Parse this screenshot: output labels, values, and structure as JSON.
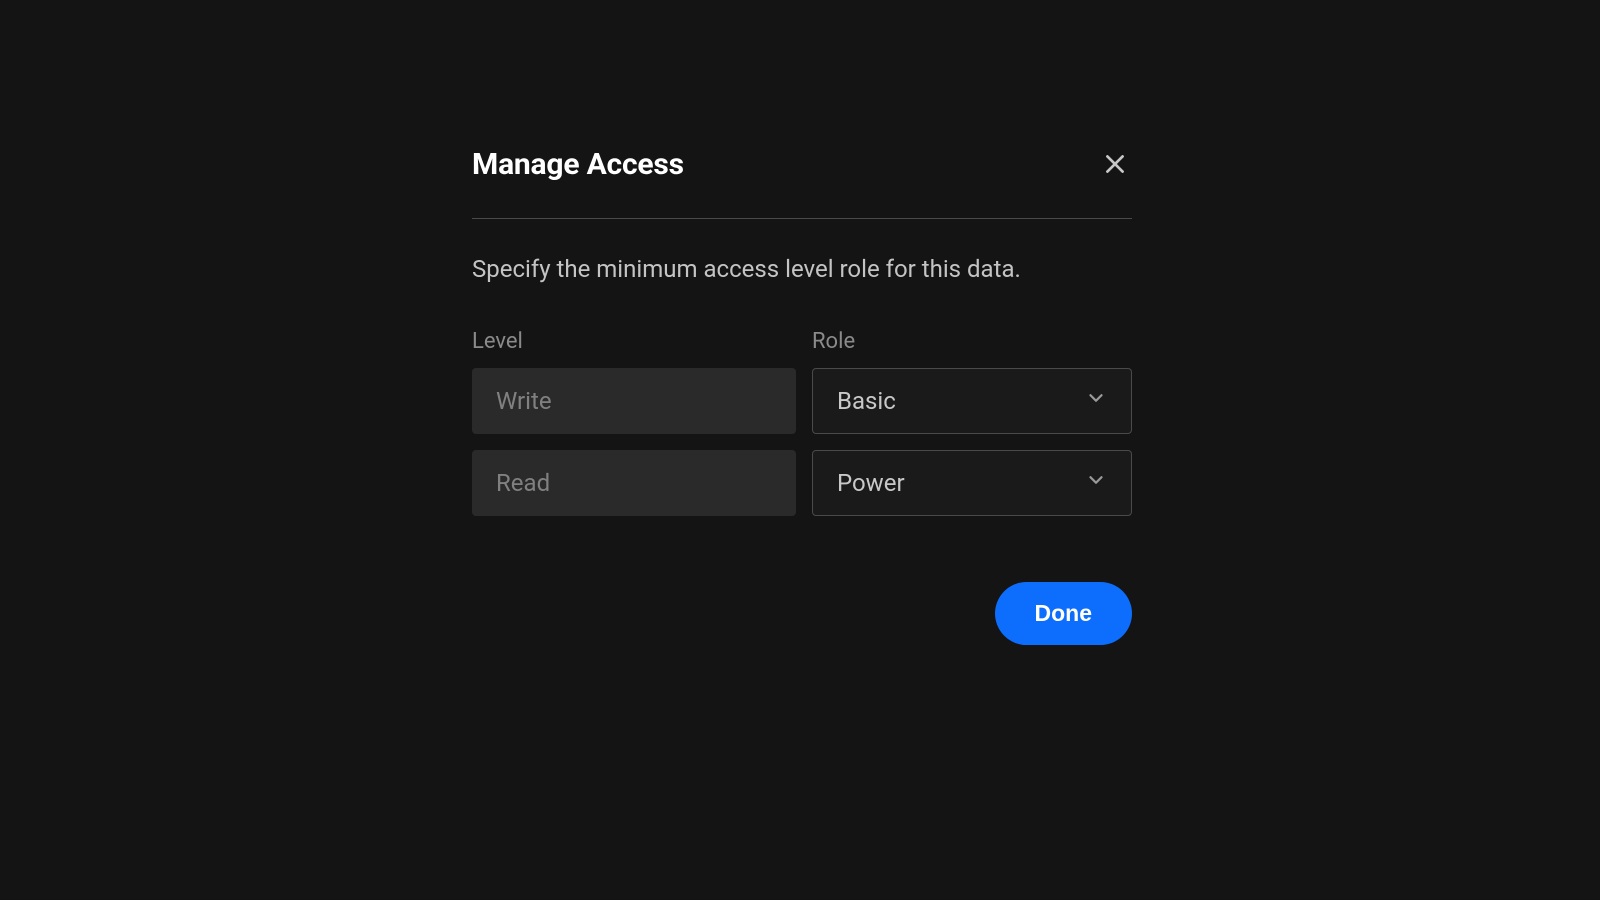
{
  "modal": {
    "title": "Manage Access",
    "description": "Specify the minimum access level role for this data.",
    "columns": {
      "level_label": "Level",
      "role_label": "Role"
    },
    "rows": [
      {
        "level": "Write",
        "role": "Basic"
      },
      {
        "level": "Read",
        "role": "Power"
      }
    ],
    "done_label": "Done"
  }
}
